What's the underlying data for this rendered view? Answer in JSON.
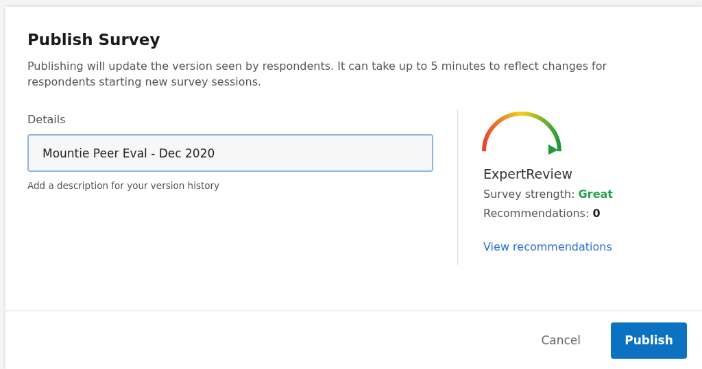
{
  "dialog": {
    "title": "Publish Survey",
    "description": "Publishing will update the version seen by respondents. It can take up to 5 minutes to reflect changes for respondents starting new survey sessions.",
    "details": {
      "label": "Details",
      "value": "Mountie Peer Eval - Dec 2020",
      "hint": "Add a description for your version history"
    },
    "expert_review": {
      "level": 1,
      "title": "ExpertReview",
      "strength": "Survey strength: **Great**",
      "recommendations": "Recommendations: **0**",
      "link": "View recommendations"
    },
    "buttons": [
      {
        "kind": "secondary",
        "label": "Cancel"
      },
      {
        "kind": "primary",
        "label": "Publish"
      }
    ]
  }
}
